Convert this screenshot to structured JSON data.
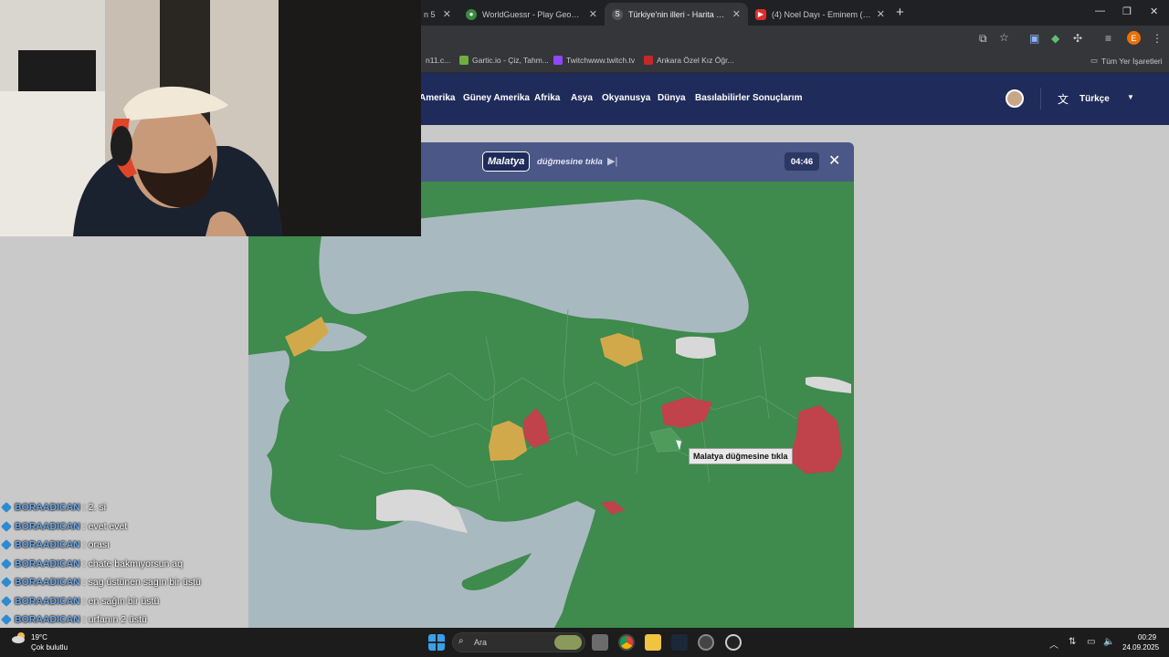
{
  "browser": {
    "tabs": [
      {
        "title": "n 5"
      },
      {
        "title": "WorldGuessr - Play Geoguessr f..."
      },
      {
        "title": "Türkiye'nin illeri - Harita Test O..."
      },
      {
        "title": "(4) Noel Dayı - Eminem (Yetişkin..."
      }
    ],
    "bookmarks": [
      {
        "label": "n11.c..."
      },
      {
        "label": "Gartic.io - Çiz, Tahm..."
      },
      {
        "label": "Twitchwww.twitch.tv"
      },
      {
        "label": "Ankara Özel Kız Öğr..."
      }
    ],
    "all_bookmarks_label": "Tüm Yer İşaretleri",
    "profile_initial": "E"
  },
  "site": {
    "nav": [
      "Amerika",
      "Güney Amerika",
      "Afrika",
      "Asya",
      "Okyanusya",
      "Dünya",
      "Basılabilirler",
      "Sonuçlarım"
    ],
    "language": "Türkçe"
  },
  "game": {
    "target": "Malatya",
    "prompt": "düğmesine tıkla",
    "timer": "04:46",
    "tooltip": "Malatya düğmesine tıkla"
  },
  "colors": {
    "correct": "#3f8a4d",
    "wrong": "#c0424a",
    "partial": "#d2a94a",
    "unanswered": "#d8d8d8",
    "sea": "#a9b9c0",
    "header": "#1f2b5a"
  },
  "chat": [
    {
      "user": "BORAADICAN",
      "message": "2. si"
    },
    {
      "user": "BORAADICAN",
      "message": "evet evet"
    },
    {
      "user": "BORAADICAN",
      "message": "orası"
    },
    {
      "user": "BORAADICAN",
      "message": "chate bakmıyorsun aq"
    },
    {
      "user": "BORAADICAN",
      "message": "sag üstünen sagın bir üstü"
    },
    {
      "user": "BORAADICAN",
      "message": "en sağın bir üstü"
    },
    {
      "user": "BORAADICAN",
      "message": "urfanın 2 üstü"
    }
  ],
  "taskbar": {
    "temperature": "19°C",
    "weather": "Çok bulutlu",
    "search_label": "Ara",
    "time": "00:29",
    "date": "24.09.2025"
  }
}
